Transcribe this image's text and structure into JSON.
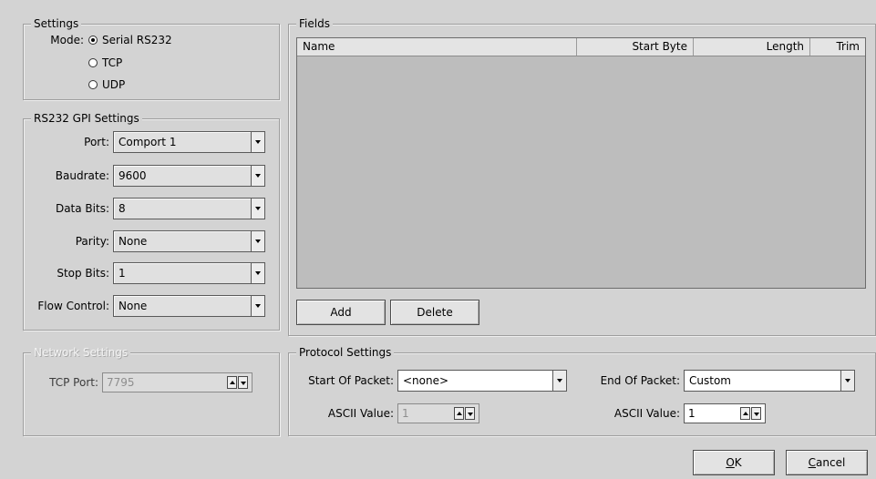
{
  "settings": {
    "title": "Settings",
    "mode_label": "Mode:",
    "modes": [
      {
        "label": "Serial RS232",
        "checked": true
      },
      {
        "label": "TCP",
        "checked": false
      },
      {
        "label": "UDP",
        "checked": false
      }
    ]
  },
  "rs232": {
    "title": "RS232 GPI Settings",
    "port": {
      "label": "Port:",
      "value": "Comport 1"
    },
    "baudrate": {
      "label": "Baudrate:",
      "value": "9600"
    },
    "data_bits": {
      "label": "Data Bits:",
      "value": "8"
    },
    "parity": {
      "label": "Parity:",
      "value": "None"
    },
    "stop_bits": {
      "label": "Stop Bits:",
      "value": "1"
    },
    "flow_control": {
      "label": "Flow Control:",
      "value": "None"
    }
  },
  "network": {
    "title": "Network Settings",
    "tcp_port_label": "TCP Port:",
    "tcp_port_value": "7795"
  },
  "fields": {
    "title": "Fields",
    "columns": [
      "Name",
      "Start Byte",
      "Length",
      "Trim"
    ],
    "rows": [],
    "add_label": "Add",
    "delete_label": "Delete"
  },
  "protocol": {
    "title": "Protocol Settings",
    "start_of_packet_label": "Start Of Packet:",
    "start_of_packet_value": "<none>",
    "start_ascii_label": "ASCII Value:",
    "start_ascii_value": "1",
    "end_of_packet_label": "End Of Packet:",
    "end_of_packet_value": "Custom",
    "end_ascii_label": "ASCII Value:",
    "end_ascii_value": "1"
  },
  "dialog": {
    "ok_mnemonic": "O",
    "ok_rest": "K",
    "cancel_mnemonic": "C",
    "cancel_rest": "ancel"
  },
  "colors": {
    "background": "#d3d3d3",
    "list_background": "#bdbdbd",
    "disabled_text": "#8e8e8e"
  }
}
